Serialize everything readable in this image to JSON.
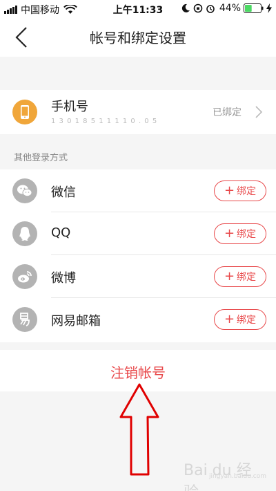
{
  "status_bar": {
    "carrier": "中国移动",
    "time": "上午11:33",
    "battery_percent": "44%",
    "battery_level": 0.44
  },
  "nav": {
    "title": "帐号和绑定设置"
  },
  "phone": {
    "title": "手机号",
    "number_masked": "1 3 0 1 8 5 1 1 1 1 0 . 0 5",
    "status": "已绑定"
  },
  "other_login": {
    "section_title": "其他登录方式",
    "bind_label": "绑定",
    "items": [
      {
        "label": "微信",
        "icon": "wechat-icon"
      },
      {
        "label": "QQ",
        "icon": "qq-icon"
      },
      {
        "label": "微博",
        "icon": "weibo-icon"
      },
      {
        "label": "网易邮箱",
        "icon": "netease-mail-icon"
      }
    ]
  },
  "cancel_account": {
    "label": "注销帐号"
  },
  "watermark": {
    "text": "Bai du 经验",
    "sub": "jingyan.baidu.com"
  },
  "colors": {
    "accent_red": "#e8484a",
    "phone_icon_bg": "#f0a63a",
    "icon_gray": "#b3b3b3"
  }
}
